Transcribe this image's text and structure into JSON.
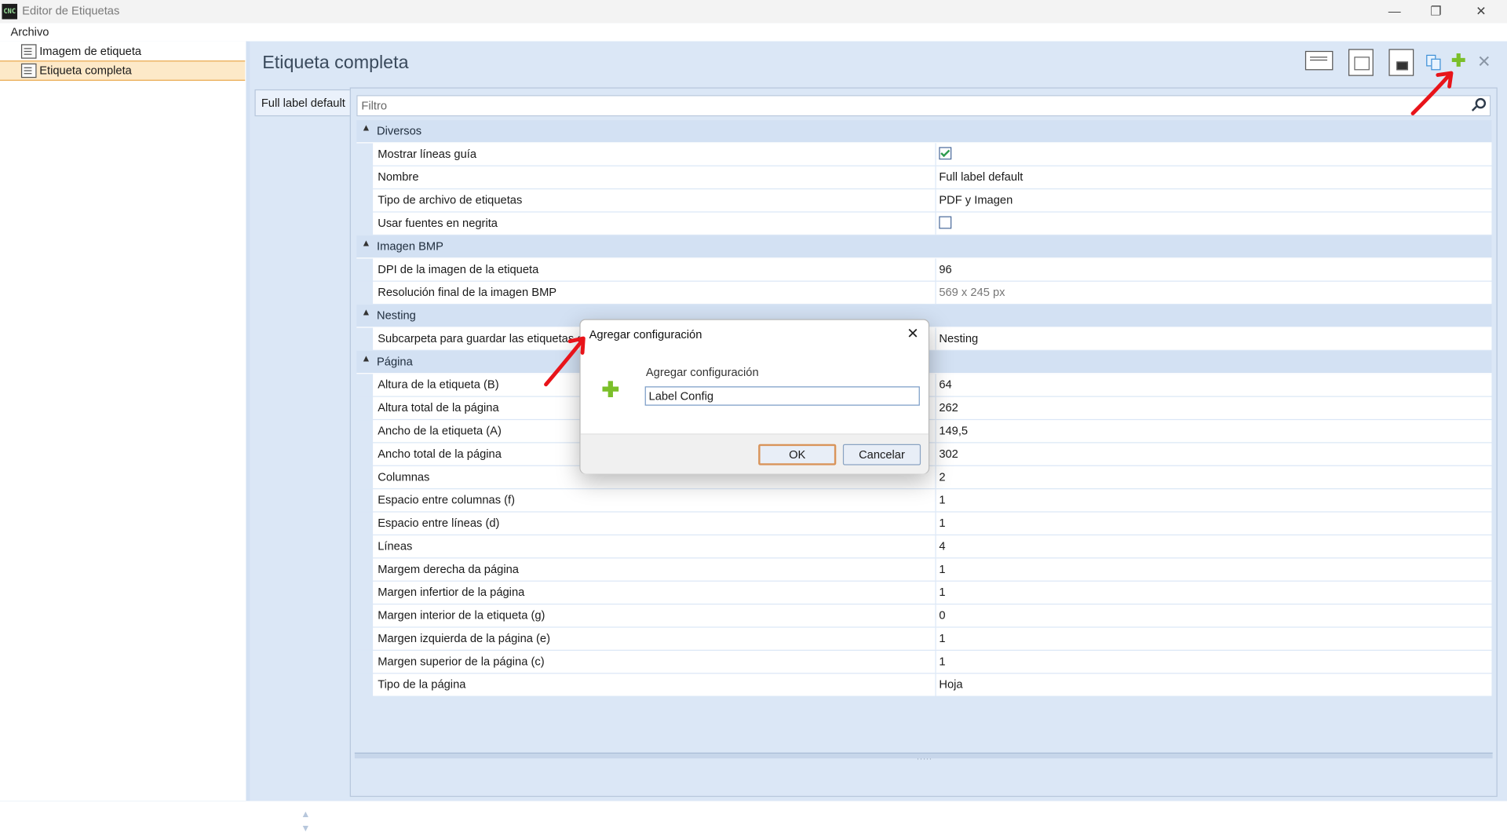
{
  "window": {
    "title": "Editor de Etiquetas",
    "icon_text": "CNC",
    "minimize": "—",
    "maximize": "❐",
    "close": "✕"
  },
  "menu": {
    "items": [
      "Archivo"
    ]
  },
  "tree": {
    "items": [
      "Imagem de etiqueta",
      "Etiqueta completa"
    ],
    "selected": 1
  },
  "main": {
    "title": "Etiqueta completa",
    "toolbar": {
      "plus": "✚",
      "close": "✕"
    },
    "tab_label": "Full label default",
    "filter_placeholder": "Filtro",
    "scroll_up": "▲",
    "scroll_down": "▼",
    "splitter_grip": "....."
  },
  "grid": {
    "categories": [
      {
        "label": "Diversos",
        "rows": [
          {
            "name": "Mostrar líneas guía",
            "type": "checkbox",
            "checked": true
          },
          {
            "name": "Nombre",
            "value": "Full label default"
          },
          {
            "name": "Tipo de archivo de etiquetas",
            "value": "PDF y Imagen"
          },
          {
            "name": "Usar fuentes en negrita",
            "type": "checkbox",
            "checked": false
          }
        ]
      },
      {
        "label": "Imagen BMP",
        "rows": [
          {
            "name": "DPI de la imagen de la etiqueta",
            "value": "96"
          },
          {
            "name": "Resolución final de la imagen BMP",
            "value": "569 x 245 px",
            "readonly": true
          }
        ]
      },
      {
        "label": "Nesting",
        "rows": [
          {
            "name": "Subcarpeta para guardar las etiquetas co",
            "value": "Nesting"
          }
        ]
      },
      {
        "label": "Página",
        "rows": [
          {
            "name": "Altura de la etiqueta (B)",
            "value": "64"
          },
          {
            "name": "Altura total de la página",
            "value": "262"
          },
          {
            "name": "Ancho de la etiqueta (A)",
            "value": "149,5"
          },
          {
            "name": "Ancho total de la página",
            "value": "302"
          },
          {
            "name": "Columnas",
            "value": "2"
          },
          {
            "name": "Espacio entre columnas (f)",
            "value": "1"
          },
          {
            "name": "Espacio entre líneas (d)",
            "value": "1"
          },
          {
            "name": "Líneas",
            "value": "4"
          },
          {
            "name": "Margem derecha da página",
            "value": "1"
          },
          {
            "name": "Margen infertior de la página",
            "value": "1"
          },
          {
            "name": "Margen interior de la etiqueta (g)",
            "value": "0"
          },
          {
            "name": "Margen izquierda de la página (e)",
            "value": "1"
          },
          {
            "name": "Margen superior de la página (c)",
            "value": "1"
          },
          {
            "name": "Tipo de la página",
            "value": "Hoja"
          }
        ]
      }
    ]
  },
  "dialog": {
    "title": "Agregar configuración",
    "close": "✕",
    "icon": "✚",
    "label": "Agregar configuración",
    "input_value": "Label Config",
    "ok": "OK",
    "cancel": "Cancelar"
  },
  "annotation_color": "#e8141a"
}
